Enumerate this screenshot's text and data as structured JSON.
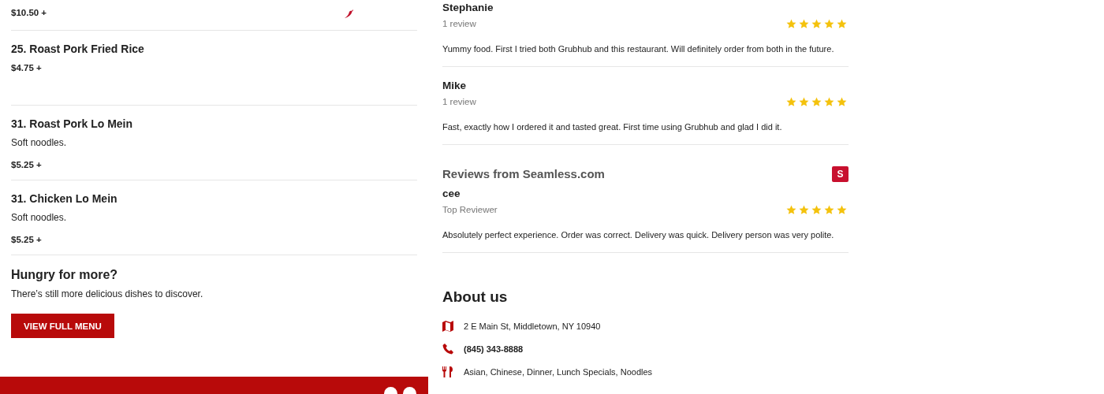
{
  "menu_items": [
    {
      "price": "$10.50 +",
      "spicy": true
    },
    {
      "name": "25. Roast Pork Fried Rice",
      "price": "$4.75 +",
      "spicy": false
    },
    {
      "name": "31. Roast Pork Lo Mein",
      "description": "Soft noodles.",
      "price": "$5.25 +",
      "spicy": false
    },
    {
      "name": "31. Chicken Lo Mein",
      "description": "Soft noodles.",
      "price": "$5.25 +",
      "spicy": false
    }
  ],
  "more": {
    "title": "Hungry for more?",
    "text": "There’s still more delicious dishes to discover.",
    "button": "VIEW FULL MENU"
  },
  "reviews": [
    {
      "name": "Stephanie",
      "meta": "1 review",
      "stars": 5,
      "text": "Yummy food. First I tried both Grubhub and this restaurant. Will definitely order from both in the future."
    },
    {
      "name": "Mike",
      "meta": "1 review",
      "stars": 5,
      "text": "Fast, exactly how I ordered it and tasted great. First time using Grubhub and glad I did it."
    }
  ],
  "seamless": {
    "title": "Reviews from Seamless.com",
    "logo": "S",
    "reviews": [
      {
        "name": "cee",
        "meta": "Top Reviewer",
        "stars": 5,
        "text": "Absolutely perfect experience. Order was correct. Delivery was quick. Delivery person was very polite."
      }
    ]
  },
  "about": {
    "title": "About us",
    "items": [
      {
        "kind": "address",
        "text": "2 E Main St, Middletown, NY 10940"
      },
      {
        "kind": "phone",
        "text": "(845) 343-8888"
      },
      {
        "kind": "cuisine",
        "text": "Asian, Chinese, Dinner, Lunch Specials, Noodles"
      }
    ]
  }
}
